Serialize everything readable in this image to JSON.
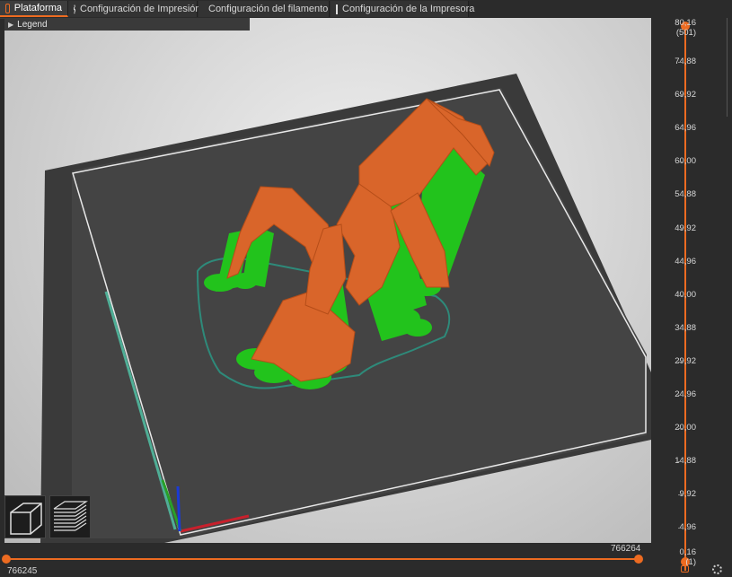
{
  "tabs": [
    {
      "label": "Plataforma",
      "icon": "plater-icon",
      "active": true
    },
    {
      "label": "Configuración de Impresión",
      "icon": "gear-icon",
      "active": false
    },
    {
      "label": "Configuración del filamento",
      "icon": "spool-icon",
      "active": false
    },
    {
      "label": "Configuración de la Impresora",
      "icon": "printer-icon",
      "active": false
    }
  ],
  "legend": {
    "label": "Legend"
  },
  "layer_slider": {
    "top_value": "80,16",
    "top_layer": "(501)",
    "ticks": [
      "74,88",
      "69,92",
      "64,96",
      "60,00",
      "54,88",
      "49,92",
      "44,96",
      "40,00",
      "34,88",
      "29,92",
      "24,96",
      "20,00",
      "14,88",
      "9,92",
      "4,96"
    ],
    "bottom_value": "0,16",
    "bottom_layer": "(1)"
  },
  "move_slider": {
    "upper_label": "766264",
    "lower_label": "766245"
  },
  "colors": {
    "accent": "#ed6b21",
    "support": "#22c31c",
    "model": "#d9652a",
    "bed": "#3a3a3a"
  },
  "view_buttons": [
    "iso-view-icon",
    "layers-view-icon"
  ]
}
